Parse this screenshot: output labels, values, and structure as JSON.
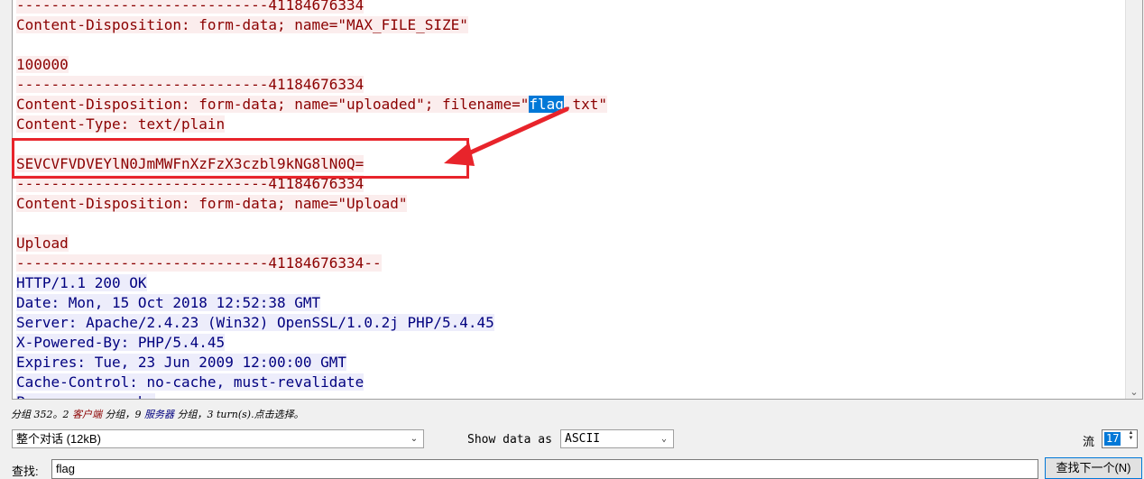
{
  "stream": {
    "lines": [
      {
        "dir": "client",
        "text": "-----------------------------41184676334"
      },
      {
        "dir": "client",
        "text": "Content-Disposition: form-data; name=\"MAX_FILE_SIZE\""
      },
      {
        "dir": "empty",
        "text": ""
      },
      {
        "dir": "client",
        "text": "100000"
      },
      {
        "dir": "client",
        "text": "-----------------------------41184676334"
      },
      {
        "dir": "client",
        "pre": "Content-Disposition: form-data; name=\"uploaded\"; filename=\"",
        "sel": "flag",
        "post": ".txt\""
      },
      {
        "dir": "client",
        "text": "Content-Type: text/plain"
      },
      {
        "dir": "empty",
        "text": ""
      },
      {
        "dir": "client",
        "text": "SEVCVFVDVEYlN0JmMWFnXzFzX3czbl9kNG8lN0Q="
      },
      {
        "dir": "client",
        "text": "-----------------------------41184676334"
      },
      {
        "dir": "client",
        "text": "Content-Disposition: form-data; name=\"Upload\""
      },
      {
        "dir": "empty",
        "text": ""
      },
      {
        "dir": "client",
        "text": "Upload"
      },
      {
        "dir": "client",
        "text": "-----------------------------41184676334--"
      },
      {
        "dir": "server",
        "text": "HTTP/1.1 200 OK"
      },
      {
        "dir": "server",
        "text": "Date: Mon, 15 Oct 2018 12:52:38 GMT"
      },
      {
        "dir": "server",
        "text": "Server: Apache/2.4.23 (Win32) OpenSSL/1.0.2j PHP/5.4.45"
      },
      {
        "dir": "server",
        "text": "X-Powered-By: PHP/5.4.45"
      },
      {
        "dir": "server",
        "text": "Expires: Tue, 23 Jun 2009 12:00:00 GMT"
      },
      {
        "dir": "server",
        "text": "Cache-Control: no-cache, must-revalidate"
      },
      {
        "dir": "server",
        "text": "Pragma: no-cache"
      }
    ]
  },
  "status": {
    "prefix": "分组 352。2 ",
    "client": "客户端",
    "mid": " 分组，9 ",
    "server": "服务器",
    "suffix": " 分组，3 turn(s).点击选择。"
  },
  "controls": {
    "conversation_select": "整个对话 (12kB)",
    "show_data_as_label": "Show data as",
    "show_data_as_value": "ASCII",
    "stream_label": "流",
    "stream_value": "17",
    "find_label": "查找:",
    "find_value": "flag",
    "find_next_button": "查找下一个(N)"
  },
  "colors": {
    "client_text": "#8b0000",
    "server_text": "#00007f",
    "annotation": "#e8242b",
    "selection": "#0078d7"
  }
}
